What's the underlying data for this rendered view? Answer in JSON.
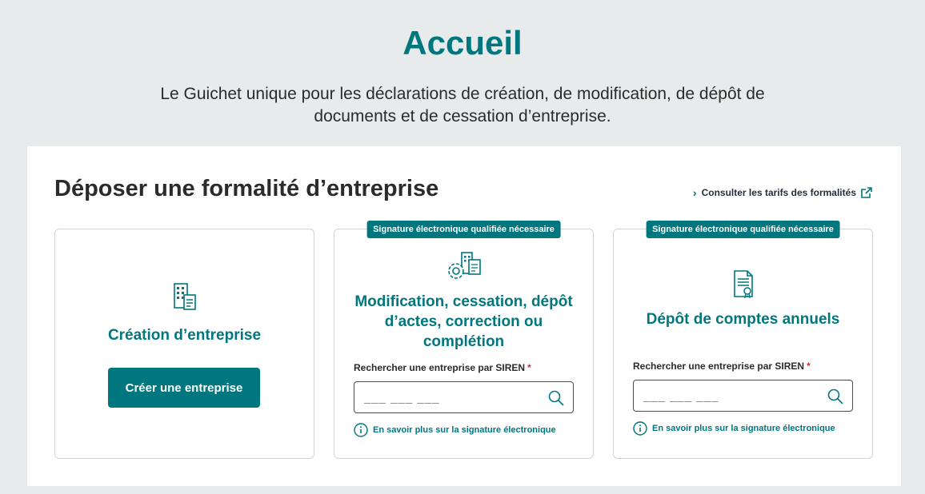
{
  "header": {
    "title": "Accueil",
    "subtitle": "Le Guichet unique pour les déclarations de création, de modification, de dépôt de documents et de cessation d’entreprise."
  },
  "section": {
    "title": "Déposer une formalité d’entreprise",
    "tarifs_link": "Consulter les tarifs des formalités"
  },
  "cards": {
    "creation": {
      "title": "Création d’entreprise",
      "button": "Créer une entreprise",
      "icon": "building-document-icon"
    },
    "modification": {
      "badge": "Signature électronique qualifiée nécessaire",
      "title": "Modification, cessation, dépôt d’actes, correction ou complétion",
      "label": "Rechercher une entreprise par SIREN",
      "required": "*",
      "placeholder": "___ ___ ___",
      "info": "En savoir plus sur la signature électronique",
      "icon": "gear-building-icon"
    },
    "comptes": {
      "badge": "Signature électronique qualifiée nécessaire",
      "title": "Dépôt de comptes annuels",
      "label": "Rechercher une entreprise par SIREN",
      "required": "*",
      "placeholder": "___ ___ ___",
      "info": "En savoir plus sur la signature électronique",
      "icon": "certificate-document-icon"
    }
  },
  "colors": {
    "accent": "#00777f",
    "background": "#e8ebeb",
    "required": "#d32f2f"
  }
}
